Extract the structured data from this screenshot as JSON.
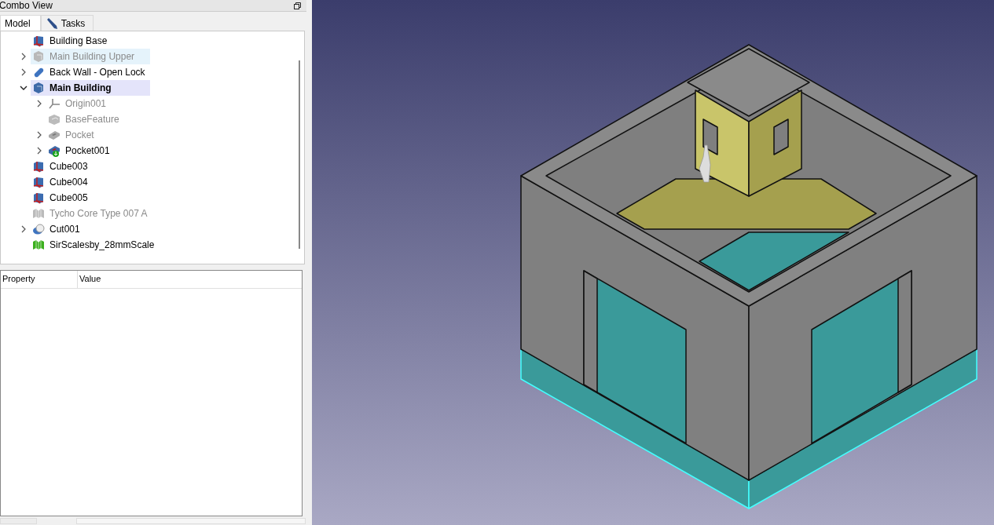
{
  "panel": {
    "title": "Combo View"
  },
  "tabs": [
    {
      "label": "Model",
      "selected": true,
      "kind": "plain"
    },
    {
      "label": "Tasks",
      "selected": false,
      "kind": "pencil"
    }
  ],
  "tree": [
    {
      "label": "Building Base",
      "kind": "cube",
      "expandable": false,
      "expanded": false,
      "hidden": false,
      "active": false,
      "selected": false,
      "preselected": false
    },
    {
      "label": "Main Building Upper",
      "kind": "body",
      "expandable": true,
      "expanded": false,
      "hidden": true,
      "active": false,
      "selected": false,
      "preselected": true
    },
    {
      "label": "Back Wall - Open Lock",
      "kind": "cylinder",
      "expandable": true,
      "expanded": false,
      "hidden": false,
      "active": false,
      "selected": false,
      "preselected": false
    },
    {
      "label": "Main Building",
      "kind": "body",
      "expandable": true,
      "expanded": true,
      "hidden": false,
      "active": true,
      "selected": true,
      "preselected": false,
      "children": [
        {
          "label": "Origin001",
          "kind": "axes",
          "expandable": true,
          "expanded": false,
          "hidden": true,
          "active": false,
          "selected": false,
          "preselected": false
        },
        {
          "label": "BaseFeature",
          "kind": "feature",
          "expandable": false,
          "expanded": false,
          "hidden": true,
          "active": false,
          "selected": false,
          "preselected": false
        },
        {
          "label": "Pocket",
          "kind": "pocket",
          "expandable": true,
          "expanded": false,
          "hidden": true,
          "active": false,
          "selected": false,
          "preselected": false
        },
        {
          "label": "Pocket001",
          "kind": "pocket-tip",
          "expandable": true,
          "expanded": false,
          "hidden": false,
          "active": false,
          "selected": false,
          "preselected": false
        }
      ]
    },
    {
      "label": "Cube003",
      "kind": "cube",
      "expandable": false,
      "expanded": false,
      "hidden": false,
      "active": false,
      "selected": false,
      "preselected": false
    },
    {
      "label": "Cube004",
      "kind": "cube",
      "expandable": false,
      "expanded": false,
      "hidden": false,
      "active": false,
      "selected": false,
      "preselected": false
    },
    {
      "label": "Cube005",
      "kind": "cube",
      "expandable": false,
      "expanded": false,
      "hidden": false,
      "active": false,
      "selected": false,
      "preselected": false
    },
    {
      "label": "Tycho Core Type 007 A",
      "kind": "mesh",
      "expandable": false,
      "expanded": false,
      "hidden": true,
      "active": false,
      "selected": false,
      "preselected": false
    },
    {
      "label": "Cut001",
      "kind": "cut",
      "expandable": true,
      "expanded": false,
      "hidden": false,
      "active": false,
      "selected": false,
      "preselected": false
    },
    {
      "label": "SirScalesby_28mmScale",
      "kind": "mesh",
      "expandable": false,
      "expanded": false,
      "hidden": false,
      "active": false,
      "selected": false,
      "preselected": false
    }
  ],
  "property_table": {
    "columns": [
      "Property",
      "Value"
    ]
  }
}
